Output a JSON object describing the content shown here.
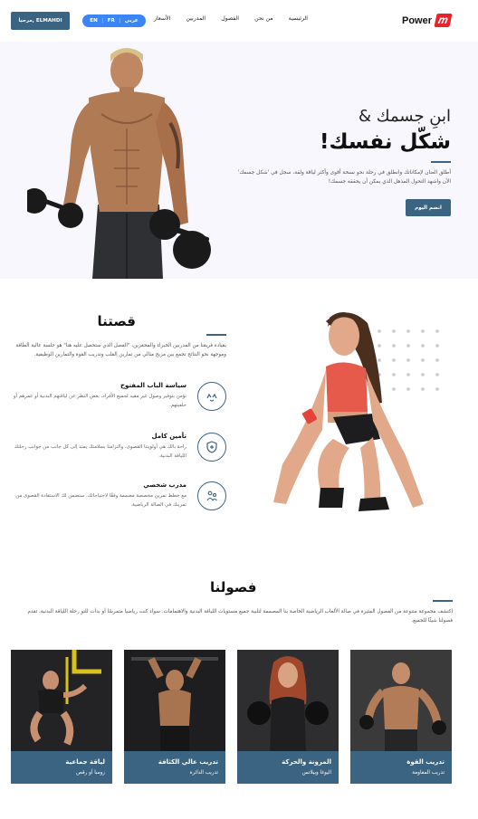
{
  "nav": {
    "logo_text": "Power",
    "logo_mark": "m",
    "menu": [
      "الرئيسية",
      "من نحن",
      "الفصول",
      "المدربين",
      "الأسعار"
    ],
    "lang": [
      "عربي",
      "FR",
      "EN"
    ],
    "login_label": "مرحبا, ELMAHDI"
  },
  "hero": {
    "title_line1": "ابنِ جسمك &",
    "title_line2": "شكّل نفسك!",
    "description": "أطلق العنان لإمكاناتك وانطلق في رحلة نحو نسخة أقوى وأكثر لياقة ولقة، سجل في 'شكل جسمك' الآن واشهد التحول المذهل الذي يمكن أن يحققه جسمك!",
    "cta_label": "انضم اليوم"
  },
  "story": {
    "title": "قصتنا",
    "description": "بقيادة فريقنا من المدربين الخبراء والمحفزين، \"الفصل الذي ستحصل عليه هنا\" هو جلسة عالية الطاقة وموجهة نحو النتائج تجمع بين مزيج مثالي من تمارين القلب وتدريب القوة والتمارين الوظيفية.",
    "features": [
      {
        "title": "سياسة الباب المفتوح",
        "desc": "نؤمن بتوفير وصول غير مقيد لجميع الأفراد، بغض النظر عن لياقتهم البدنية أو عمرهم أو خلفيتهم.",
        "icon": "hands-icon"
      },
      {
        "title": "تأمين كامل",
        "desc": "راحة بالك هي أولويتنا القصوى، والتزامنا بسلامتك يمتد إلى كل جانب من جوانب رحلتك اللياقة البدنية.",
        "icon": "shield-icon"
      },
      {
        "title": "مدرب شخصي",
        "desc": "مع خطط تمرين مخصصة مصممة وفقًا لاحتياجاتك، ستضمن لك الاستفادة القصوى من تمرينك في الصالة الرياضية.",
        "icon": "trainer-icon"
      }
    ]
  },
  "classes": {
    "title": "فصولنا",
    "description": "اكتشف مجموعة متنوعة من الفصول المثيرة في صالة الألعاب الرياضية الخاصة بنا المصممة لتلبية جميع مستويات اللياقة البدنية والاهتمامات. سواء كنت رياضيا متمرسًا أو بدأت للتو رحلة اللياقة البدنية، تقدم فصولنا شيئًا للجميع.",
    "cards": [
      {
        "title": "تدريب القوة",
        "subtitle": "تدريب المقاومة"
      },
      {
        "title": "المرونة والحركة",
        "subtitle": "اليوغا وبيلاتس"
      },
      {
        "title": "تدريب عالي الكثافة",
        "subtitle": "تدريب الدائرة"
      },
      {
        "title": "لياقة جماعية",
        "subtitle": "زومبا أو رقص"
      }
    ]
  },
  "colors": {
    "accent": "#3b6482",
    "brand_red": "#e8232a",
    "lang_blue": "#3a86f6",
    "hero_bg": "#f7f7fd"
  }
}
